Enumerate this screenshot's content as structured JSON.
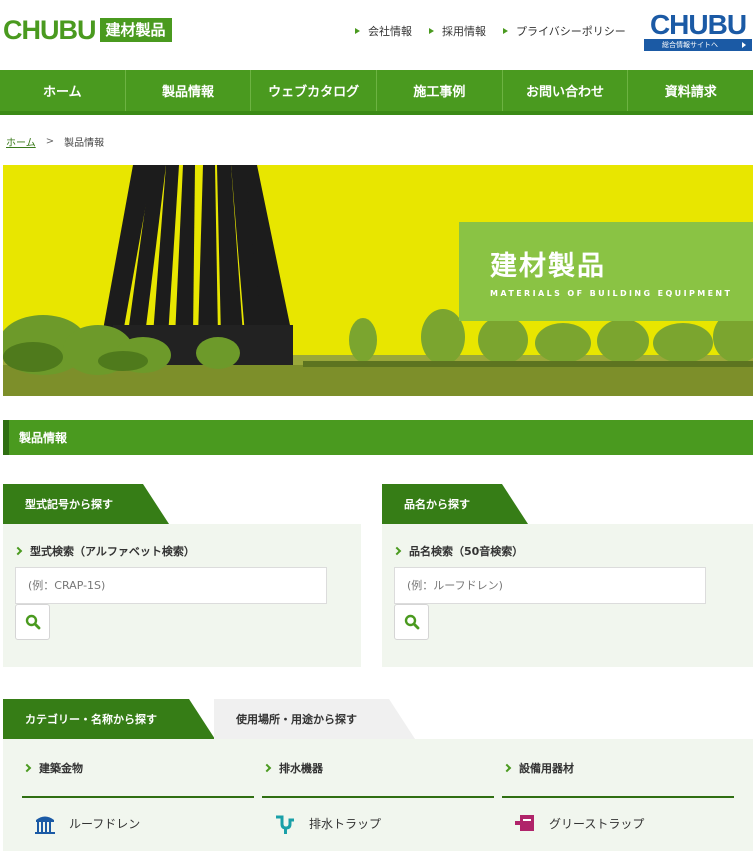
{
  "header": {
    "logo_text": "CHUBU",
    "logo_badge": "建材製品",
    "links": [
      "会社情報",
      "採用情報",
      "プライバシーポリシー"
    ],
    "corp_logo": "CHUBU",
    "corp_sub": "総合情報サイトへ"
  },
  "nav": [
    "ホーム",
    "製品情報",
    "ウェブカタログ",
    "施工事例",
    "お問い合わせ",
    "資料請求"
  ],
  "breadcrumb": {
    "home": "ホーム",
    "sep": ">",
    "current": "製品情報"
  },
  "hero": {
    "title": "建材製品",
    "subtitle": "MATERIALS OF BUILDING EQUIPMENT"
  },
  "section_title": "製品情報",
  "search_model": {
    "tab": "型式記号から探す",
    "label": "型式検索（アルファベット検索）",
    "placeholder": "(例：CRAP-1S)"
  },
  "search_name": {
    "tab": "品名から探す",
    "label": "品名検索（50音検索）",
    "placeholder": "(例：ルーフドレン)"
  },
  "category_tabs": {
    "active": "カテゴリー・名称から探す",
    "inactive": "使用場所・用途から探す"
  },
  "categories": [
    {
      "head": "建築金物",
      "item": "ルーフドレン",
      "icon": "roof-drain-icon"
    },
    {
      "head": "排水機器",
      "item": "排水トラップ",
      "icon": "drain-trap-icon"
    },
    {
      "head": "設備用器材",
      "item": "グリーストラップ",
      "icon": "grease-trap-icon"
    }
  ],
  "colors": {
    "brand_green": "#4a9a1f",
    "dark_green": "#367d16",
    "corp_blue": "#1b5aa5",
    "hero_yellow": "#e8e600",
    "hero_box": "#8ac344"
  }
}
